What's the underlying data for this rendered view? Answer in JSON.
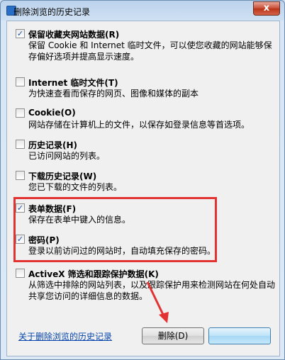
{
  "window": {
    "title": "删除浏览的历史记录",
    "close_label": "x"
  },
  "options": [
    {
      "title": "保留收藏夹网站数据(R)",
      "desc": "保留 Cookie 和 Internet 临时文件，可以使您收藏的网站能够保存偏好选项并提高显示速度。",
      "checked": true
    },
    {
      "title": "Internet 临时文件(T)",
      "desc": "为快速查看而保存的网页、图像和媒体的副本",
      "checked": false
    },
    {
      "title": "Cookie(O)",
      "desc": "网站存储在计算机上的文件，以保存如登录信息等首选项。",
      "checked": false
    },
    {
      "title": "历史记录(H)",
      "desc": "已访问网站的列表。",
      "checked": false
    },
    {
      "title": "下载历史记录(W)",
      "desc": "您已下载的文件的列表。",
      "checked": false
    },
    {
      "title": "表单数据(F)",
      "desc": "保存在表单中键入的信息。",
      "checked": true
    },
    {
      "title": "密码(P)",
      "desc": "登录以前访问过的网站时，自动填充保存的密码。",
      "checked": true
    },
    {
      "title": "ActiveX 筛选和跟踪保护数据(K)",
      "desc": "从筛选中排除的网站列表，以及跟踪保护用来检测网站在何处自动共享您访问的详细信息的数据。",
      "checked": false
    }
  ],
  "footer": {
    "link_label": "关于删除浏览的历史记录",
    "delete_label": "删除(D)",
    "cancel_label": ""
  },
  "colors": {
    "highlight": "#e23232",
    "arrow": "#e23232",
    "link": "#0645ad"
  },
  "icons": {
    "title": "ie-window-icon",
    "close": "close-icon",
    "check": "checkmark-icon"
  }
}
